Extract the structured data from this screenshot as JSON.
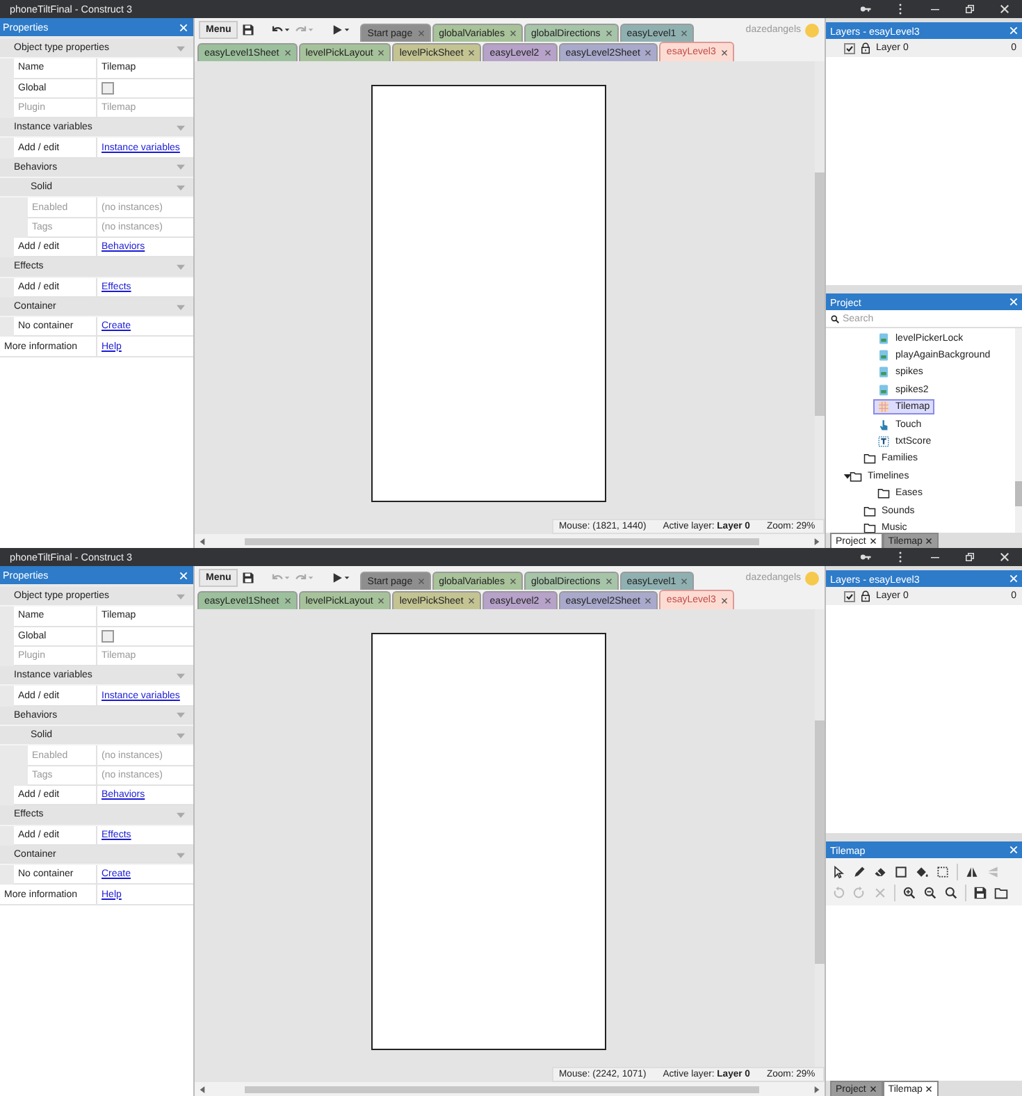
{
  "windows": [
    {
      "title": "phoneTiltFinal - Construct 3",
      "properties": {
        "title": "Properties",
        "rows": [
          {
            "kind": "section",
            "label": "Object type properties",
            "expanded": true,
            "children": [
              {
                "kind": "field",
                "label": "Name",
                "value": "Tilemap",
                "disabled": false
              },
              {
                "kind": "checkbox",
                "label": "Global",
                "checked": false
              },
              {
                "kind": "field",
                "label": "Plugin",
                "value": "Tilemap",
                "disabled": true
              }
            ]
          },
          {
            "kind": "section",
            "label": "Instance variables",
            "expanded": true,
            "children": [
              {
                "kind": "link",
                "label": "Add / edit",
                "value": "Instance variables"
              }
            ]
          },
          {
            "kind": "section",
            "label": "Behaviors",
            "expanded": true,
            "children": [
              {
                "kind": "section",
                "label": "Solid",
                "expanded": true,
                "children": [
                  {
                    "kind": "field",
                    "label": "Enabled",
                    "value": "(no instances)",
                    "disabled": true
                  },
                  {
                    "kind": "field",
                    "label": "Tags",
                    "value": "(no instances)",
                    "disabled": true
                  }
                ]
              },
              {
                "kind": "link",
                "label": "Add / edit",
                "value": "Behaviors"
              }
            ]
          },
          {
            "kind": "section",
            "label": "Effects",
            "expanded": true,
            "children": [
              {
                "kind": "link",
                "label": "Add / edit",
                "value": "Effects"
              }
            ]
          },
          {
            "kind": "section",
            "label": "Container",
            "expanded": true,
            "children": [
              {
                "kind": "link",
                "label": "No container",
                "value": "Create"
              }
            ]
          },
          {
            "kind": "link",
            "label": "More information",
            "value": "Help"
          }
        ]
      },
      "toolbar": {
        "menu": "Menu",
        "undo_disabled": false,
        "redo_disabled": true
      },
      "user": "dazedangels",
      "tab_rows": [
        [
          {
            "label": "Start page",
            "color": "#8e8e8e",
            "selected": false
          },
          {
            "label": "globalVariables",
            "color": "#a8c29a",
            "selected": false
          },
          {
            "label": "globalDirections",
            "color": "#a6c4a8",
            "selected": false
          },
          {
            "label": "easyLevel1",
            "color": "#8fb0b0",
            "selected": false
          }
        ],
        [
          {
            "label": "easyLevel1Sheet",
            "color": "#9cc09c",
            "selected": false
          },
          {
            "label": "levelPickLayout",
            "color": "#a6c29a",
            "selected": false
          },
          {
            "label": "levelPickSheet",
            "color": "#c4c493",
            "selected": false
          },
          {
            "label": "easyLevel2",
            "color": "#b7a2c9",
            "selected": false
          },
          {
            "label": "easyLevel2Sheet",
            "color": "#a9a9cc",
            "selected": false
          },
          {
            "label": "esayLevel3",
            "color": "#fcdcd2",
            "selected": true
          }
        ]
      ],
      "status": {
        "mouse": "Mouse: (1821, 1440)",
        "layer": "Active layer: **Layer 0**",
        "zoom": "Zoom: 29%"
      },
      "layers": {
        "title": "Layers - esayLevel3",
        "items": [
          {
            "name": "Layer 0",
            "visible": true,
            "count": "0"
          }
        ]
      },
      "side_panel": {
        "kind": "project",
        "title": "Project",
        "search": {
          "placeholder": "Search"
        },
        "tree": [
          {
            "label": "levelPickerLock",
            "kind": "sprite",
            "selected": false
          },
          {
            "label": "playAgainBackground",
            "kind": "sprite",
            "selected": false
          },
          {
            "label": "spikes",
            "kind": "sprite",
            "selected": false
          },
          {
            "label": "spikes2",
            "kind": "sprite",
            "selected": false
          },
          {
            "label": "Tilemap",
            "kind": "tilemap",
            "selected": true
          },
          {
            "label": "Touch",
            "kind": "touch",
            "selected": false
          },
          {
            "label": "txtScore",
            "kind": "text",
            "selected": false
          },
          {
            "label": "Families",
            "kind": "folder",
            "selected": false
          },
          {
            "label": "Timelines",
            "kind": "folder",
            "selected": false,
            "expanded": true,
            "children": [
              {
                "label": "Eases",
                "kind": "folder",
                "selected": false
              }
            ]
          },
          {
            "label": "Sounds",
            "kind": "folder",
            "selected": false
          },
          {
            "label": "Music",
            "kind": "folder",
            "selected": false
          }
        ]
      },
      "panel_tabs": [
        {
          "label": "Project",
          "selected": true
        },
        {
          "label": "Tilemap",
          "selected": false
        }
      ]
    },
    {
      "title": "phoneTiltFinal - Construct 3",
      "properties": {
        "title": "Properties",
        "rows": [
          {
            "kind": "section",
            "label": "Object type properties",
            "expanded": true,
            "children": [
              {
                "kind": "field",
                "label": "Name",
                "value": "Tilemap",
                "disabled": false
              },
              {
                "kind": "checkbox",
                "label": "Global",
                "checked": false
              },
              {
                "kind": "field",
                "label": "Plugin",
                "value": "Tilemap",
                "disabled": true
              }
            ]
          },
          {
            "kind": "section",
            "label": "Instance variables",
            "expanded": true,
            "children": [
              {
                "kind": "link",
                "label": "Add / edit",
                "value": "Instance variables"
              }
            ]
          },
          {
            "kind": "section",
            "label": "Behaviors",
            "expanded": true,
            "children": [
              {
                "kind": "section",
                "label": "Solid",
                "expanded": true,
                "children": [
                  {
                    "kind": "field",
                    "label": "Enabled",
                    "value": "(no instances)",
                    "disabled": true
                  },
                  {
                    "kind": "field",
                    "label": "Tags",
                    "value": "(no instances)",
                    "disabled": true
                  }
                ]
              },
              {
                "kind": "link",
                "label": "Add / edit",
                "value": "Behaviors"
              }
            ]
          },
          {
            "kind": "section",
            "label": "Effects",
            "expanded": true,
            "children": [
              {
                "kind": "link",
                "label": "Add / edit",
                "value": "Effects"
              }
            ]
          },
          {
            "kind": "section",
            "label": "Container",
            "expanded": true,
            "children": [
              {
                "kind": "link",
                "label": "No container",
                "value": "Create"
              }
            ]
          },
          {
            "kind": "link",
            "label": "More information",
            "value": "Help"
          }
        ]
      },
      "toolbar": {
        "menu": "Menu",
        "undo_disabled": true,
        "redo_disabled": true
      },
      "user": "dazedangels",
      "tab_rows": [
        [
          {
            "label": "Start page",
            "color": "#8e8e8e",
            "selected": false
          },
          {
            "label": "globalVariables",
            "color": "#a8c29a",
            "selected": false
          },
          {
            "label": "globalDirections",
            "color": "#a6c4a8",
            "selected": false
          },
          {
            "label": "easyLevel1",
            "color": "#8fb0b0",
            "selected": false
          }
        ],
        [
          {
            "label": "easyLevel1Sheet",
            "color": "#9cc09c",
            "selected": false
          },
          {
            "label": "levelPickLayout",
            "color": "#a6c29a",
            "selected": false
          },
          {
            "label": "levelPickSheet",
            "color": "#c4c493",
            "selected": false
          },
          {
            "label": "easyLevel2",
            "color": "#b7a2c9",
            "selected": false
          },
          {
            "label": "easyLevel2Sheet",
            "color": "#a9a9cc",
            "selected": false
          },
          {
            "label": "esayLevel3",
            "color": "#fcdcd2",
            "selected": true
          }
        ]
      ],
      "status": {
        "mouse": "Mouse: (2242, 1071)",
        "layer": "Active layer: **Layer 0**",
        "zoom": "Zoom: 29%"
      },
      "layers": {
        "title": "Layers - esayLevel3",
        "items": [
          {
            "name": "Layer 0",
            "visible": true,
            "count": "0"
          }
        ]
      },
      "side_panel": {
        "kind": "tilemap",
        "title": "Tilemap",
        "tool_rows": [
          [
            [
              {
                "kind": "pointer",
                "disabled": false
              },
              {
                "kind": "pencil",
                "disabled": false
              },
              {
                "kind": "eraser",
                "disabled": false
              },
              {
                "kind": "rectangle",
                "disabled": false
              },
              {
                "kind": "fill",
                "disabled": false
              },
              {
                "kind": "selection",
                "disabled": false
              }
            ],
            [
              {
                "kind": "flip-h",
                "disabled": false
              },
              {
                "kind": "flip-v",
                "disabled": true
              }
            ]
          ],
          [
            [
              {
                "kind": "rotate-ccw",
                "disabled": true
              },
              {
                "kind": "rotate-cw",
                "disabled": true
              },
              {
                "kind": "delete",
                "disabled": true
              }
            ],
            [
              {
                "kind": "zoom-in",
                "disabled": false
              },
              {
                "kind": "zoom-out",
                "disabled": false
              },
              {
                "kind": "zoom-reset",
                "disabled": false
              }
            ],
            [
              {
                "kind": "save",
                "disabled": false
              },
              {
                "kind": "open",
                "disabled": false
              }
            ]
          ]
        ]
      },
      "panel_tabs": [
        {
          "label": "Project",
          "selected": false
        },
        {
          "label": "Tilemap",
          "selected": true
        }
      ]
    }
  ]
}
